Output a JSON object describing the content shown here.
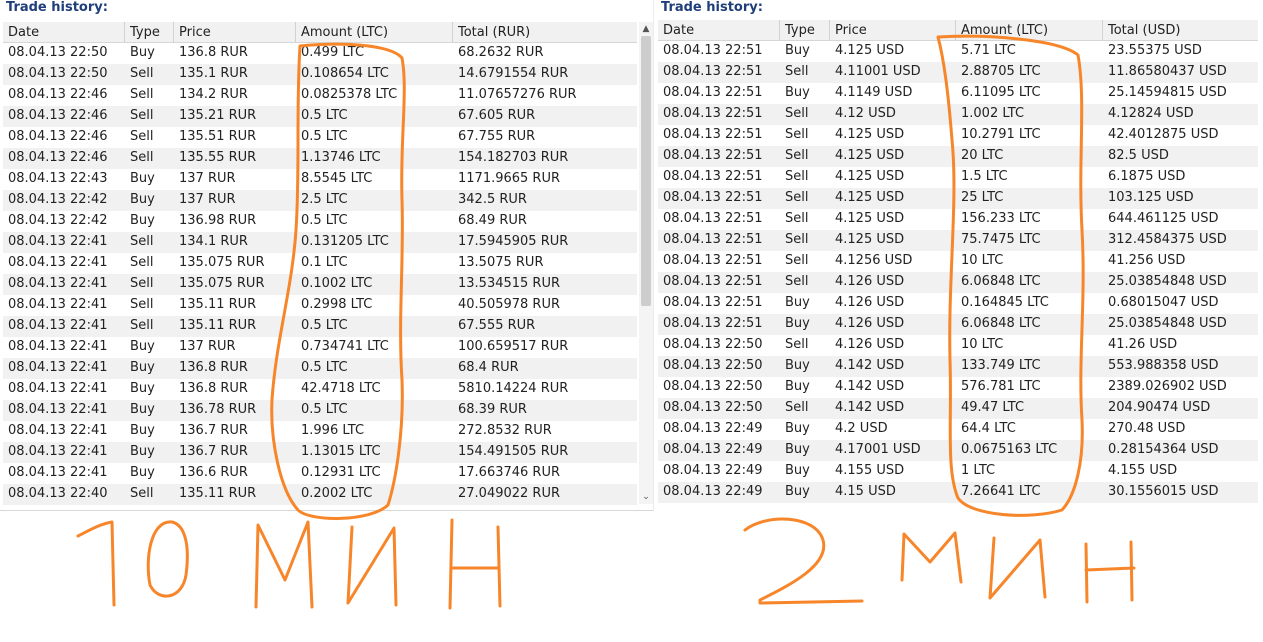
{
  "left": {
    "title": "Trade history:",
    "columns": [
      "Date",
      "Type",
      "Price",
      "Amount (LTC)",
      "Total (RUR)"
    ],
    "rows": [
      [
        "08.04.13 22:50",
        "Buy",
        "136.8 RUR",
        "0.499 LTC",
        "68.2632 RUR"
      ],
      [
        "08.04.13 22:50",
        "Sell",
        "135.1 RUR",
        "0.108654 LTC",
        "14.6791554 RUR"
      ],
      [
        "08.04.13 22:46",
        "Sell",
        "134.2 RUR",
        "0.0825378 LTC",
        "11.07657276 RUR"
      ],
      [
        "08.04.13 22:46",
        "Sell",
        "135.21 RUR",
        "0.5 LTC",
        "67.605 RUR"
      ],
      [
        "08.04.13 22:46",
        "Sell",
        "135.51 RUR",
        "0.5 LTC",
        "67.755 RUR"
      ],
      [
        "08.04.13 22:46",
        "Sell",
        "135.55 RUR",
        "1.13746 LTC",
        "154.182703 RUR"
      ],
      [
        "08.04.13 22:43",
        "Buy",
        "137 RUR",
        "8.5545 LTC",
        "1171.9665 RUR"
      ],
      [
        "08.04.13 22:42",
        "Buy",
        "137 RUR",
        "2.5 LTC",
        "342.5 RUR"
      ],
      [
        "08.04.13 22:42",
        "Buy",
        "136.98 RUR",
        "0.5 LTC",
        "68.49 RUR"
      ],
      [
        "08.04.13 22:41",
        "Sell",
        "134.1 RUR",
        "0.131205 LTC",
        "17.5945905 RUR"
      ],
      [
        "08.04.13 22:41",
        "Sell",
        "135.075 RUR",
        "0.1 LTC",
        "13.5075 RUR"
      ],
      [
        "08.04.13 22:41",
        "Sell",
        "135.075 RUR",
        "0.1002 LTC",
        "13.534515 RUR"
      ],
      [
        "08.04.13 22:41",
        "Sell",
        "135.11 RUR",
        "0.2998 LTC",
        "40.505978 RUR"
      ],
      [
        "08.04.13 22:41",
        "Sell",
        "135.11 RUR",
        "0.5 LTC",
        "67.555 RUR"
      ],
      [
        "08.04.13 22:41",
        "Buy",
        "137 RUR",
        "0.734741 LTC",
        "100.659517 RUR"
      ],
      [
        "08.04.13 22:41",
        "Buy",
        "136.8 RUR",
        "0.5 LTC",
        "68.4 RUR"
      ],
      [
        "08.04.13 22:41",
        "Buy",
        "136.8 RUR",
        "42.4718 LTC",
        "5810.14224 RUR"
      ],
      [
        "08.04.13 22:41",
        "Buy",
        "136.78 RUR",
        "0.5 LTC",
        "68.39 RUR"
      ],
      [
        "08.04.13 22:41",
        "Buy",
        "136.7 RUR",
        "1.996 LTC",
        "272.8532 RUR"
      ],
      [
        "08.04.13 22:41",
        "Buy",
        "136.7 RUR",
        "1.13015 LTC",
        "154.491505 RUR"
      ],
      [
        "08.04.13 22:41",
        "Buy",
        "136.6 RUR",
        "0.12931 LTC",
        "17.663746 RUR"
      ],
      [
        "08.04.13 22:40",
        "Sell",
        "135.11 RUR",
        "0.2002 LTC",
        "27.049022 RUR"
      ]
    ],
    "scroll_up_glyph": "▲",
    "scroll_down_glyph": "⌄"
  },
  "right": {
    "title": "Trade history:",
    "columns": [
      "Date",
      "Type",
      "Price",
      "Amount (LTC)",
      "Total (USD)"
    ],
    "rows": [
      [
        "08.04.13 22:51",
        "Buy",
        "4.125 USD",
        "5.71 LTC",
        "23.55375 USD"
      ],
      [
        "08.04.13 22:51",
        "Sell",
        "4.11001 USD",
        "2.88705 LTC",
        "11.86580437 USD"
      ],
      [
        "08.04.13 22:51",
        "Buy",
        "4.1149 USD",
        "6.11095 LTC",
        "25.14594815 USD"
      ],
      [
        "08.04.13 22:51",
        "Sell",
        "4.12 USD",
        "1.002 LTC",
        "4.12824 USD"
      ],
      [
        "08.04.13 22:51",
        "Sell",
        "4.125 USD",
        "10.2791 LTC",
        "42.4012875 USD"
      ],
      [
        "08.04.13 22:51",
        "Sell",
        "4.125 USD",
        "20 LTC",
        "82.5 USD"
      ],
      [
        "08.04.13 22:51",
        "Sell",
        "4.125 USD",
        "1.5 LTC",
        "6.1875 USD"
      ],
      [
        "08.04.13 22:51",
        "Sell",
        "4.125 USD",
        "25 LTC",
        "103.125 USD"
      ],
      [
        "08.04.13 22:51",
        "Sell",
        "4.125 USD",
        "156.233 LTC",
        "644.461125 USD"
      ],
      [
        "08.04.13 22:51",
        "Sell",
        "4.125 USD",
        "75.7475 LTC",
        "312.4584375 USD"
      ],
      [
        "08.04.13 22:51",
        "Sell",
        "4.1256 USD",
        "10 LTC",
        "41.256 USD"
      ],
      [
        "08.04.13 22:51",
        "Sell",
        "4.126 USD",
        "6.06848 LTC",
        "25.03854848 USD"
      ],
      [
        "08.04.13 22:51",
        "Buy",
        "4.126 USD",
        "0.164845 LTC",
        "0.68015047 USD"
      ],
      [
        "08.04.13 22:51",
        "Buy",
        "4.126 USD",
        "6.06848 LTC",
        "25.03854848 USD"
      ],
      [
        "08.04.13 22:50",
        "Sell",
        "4.126 USD",
        "10 LTC",
        "41.26 USD"
      ],
      [
        "08.04.13 22:50",
        "Buy",
        "4.142 USD",
        "133.749 LTC",
        "553.988358 USD"
      ],
      [
        "08.04.13 22:50",
        "Buy",
        "4.142 USD",
        "576.781 LTC",
        "2389.026902 USD"
      ],
      [
        "08.04.13 22:50",
        "Sell",
        "4.142 USD",
        "49.47 LTC",
        "204.90474 USD"
      ],
      [
        "08.04.13 22:49",
        "Buy",
        "4.2 USD",
        "64.4 LTC",
        "270.48 USD"
      ],
      [
        "08.04.13 22:49",
        "Buy",
        "4.17001 USD",
        "0.0675163 LTC",
        "0.28154364 USD"
      ],
      [
        "08.04.13 22:49",
        "Buy",
        "4.155 USD",
        "1 LTC",
        "4.155 USD"
      ],
      [
        "08.04.13 22:49",
        "Buy",
        "4.15 USD",
        "7.26641 LTC",
        "30.1556015 USD"
      ]
    ]
  },
  "annotations": {
    "color": "#f7862a",
    "left_caption": "10 мин",
    "right_caption": "2 мин"
  }
}
